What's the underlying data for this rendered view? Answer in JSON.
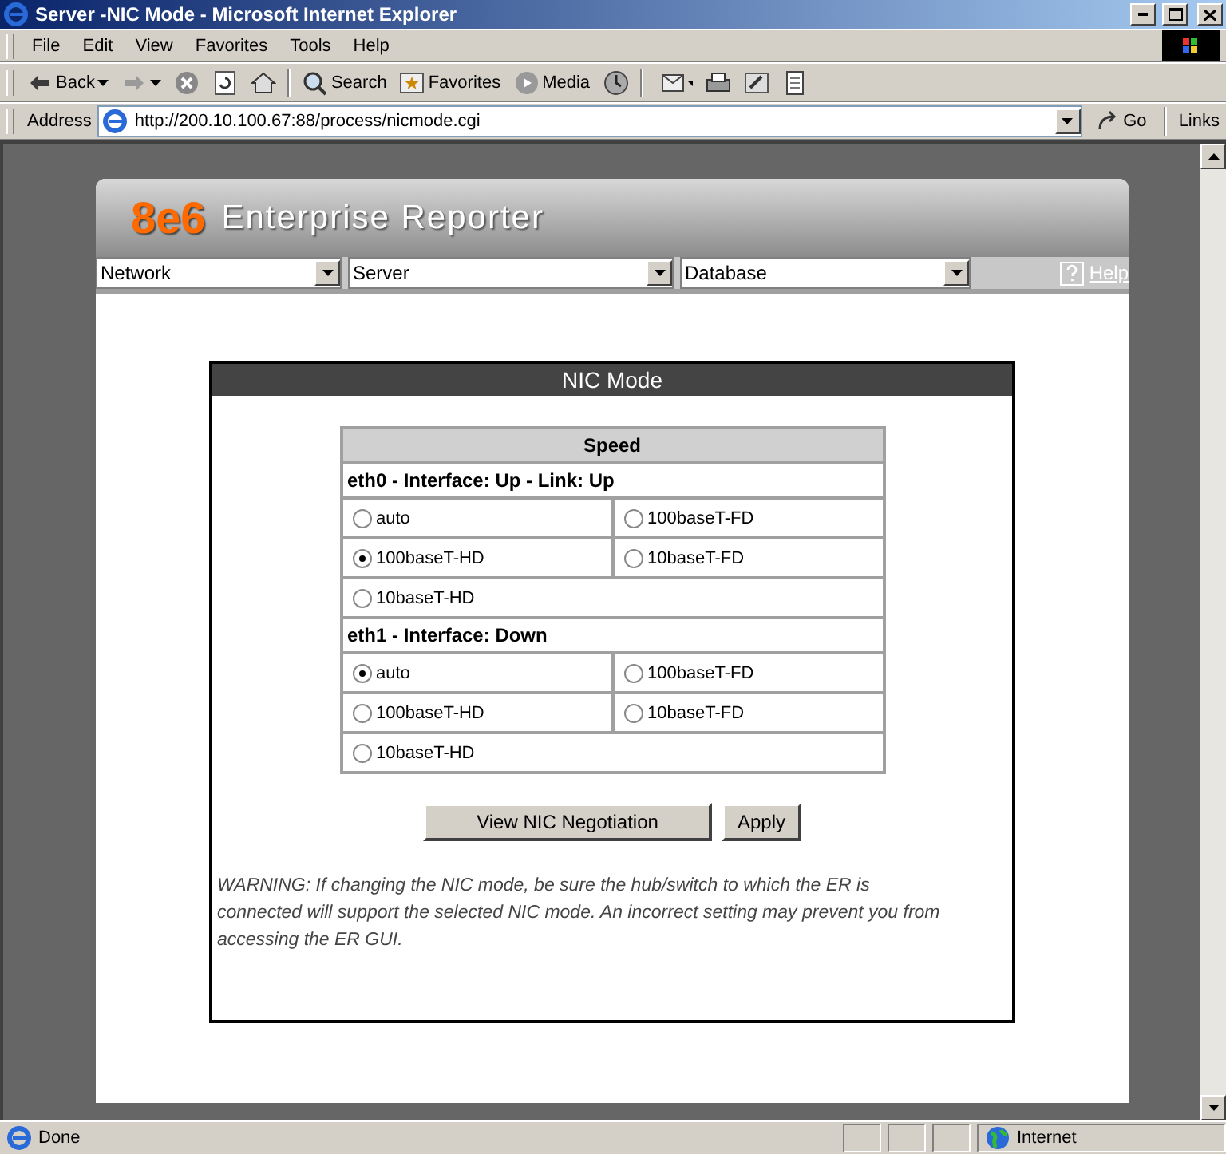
{
  "window": {
    "title": "Server -NIC Mode - Microsoft Internet Explorer"
  },
  "menu": [
    "File",
    "Edit",
    "View",
    "Favorites",
    "Tools",
    "Help"
  ],
  "toolbar": [
    {
      "kind": "back",
      "label": "Back"
    },
    {
      "kind": "forward"
    },
    {
      "kind": "stop"
    },
    {
      "kind": "refresh"
    },
    {
      "kind": "home"
    },
    {
      "kind": "sep"
    },
    {
      "kind": "search",
      "label": "Search"
    },
    {
      "kind": "favorites",
      "label": "Favorites"
    },
    {
      "kind": "media",
      "label": "Media"
    },
    {
      "kind": "history"
    },
    {
      "kind": "sep"
    },
    {
      "kind": "mail"
    },
    {
      "kind": "print"
    },
    {
      "kind": "edit"
    },
    {
      "kind": "discuss"
    }
  ],
  "address": {
    "label": "Address",
    "url": "http://200.10.100.67:88/process/nicmode.cgi",
    "go": "Go",
    "links": "Links"
  },
  "app": {
    "logo": "8e6",
    "title": "Enterprise Reporter",
    "menus": [
      "Network",
      "Server",
      "Database"
    ],
    "help": "Help"
  },
  "panel": {
    "title": "NIC Mode",
    "table_header": "Speed",
    "interfaces": [
      {
        "heading": "eth0 - Interface: Up - Link: Up",
        "options": [
          {
            "label": "auto",
            "selected": false
          },
          {
            "label": "100baseT-FD",
            "selected": false
          },
          {
            "label": "100baseT-HD",
            "selected": true
          },
          {
            "label": "10baseT-FD",
            "selected": false
          },
          {
            "label": "10baseT-HD",
            "selected": false
          }
        ]
      },
      {
        "heading": "eth1 - Interface: Down",
        "options": [
          {
            "label": "auto",
            "selected": true
          },
          {
            "label": "100baseT-FD",
            "selected": false
          },
          {
            "label": "100baseT-HD",
            "selected": false
          },
          {
            "label": "10baseT-FD",
            "selected": false
          },
          {
            "label": "10baseT-HD",
            "selected": false
          }
        ]
      }
    ],
    "buttons": [
      "View NIC Negotiation",
      "Apply"
    ],
    "warning": "WARNING: If changing the NIC mode, be sure the hub/switch to which the ER is connected will support the selected NIC mode. An incorrect setting may prevent you from accessing the ER GUI."
  },
  "status": {
    "text": "Done",
    "zone": "Internet"
  }
}
